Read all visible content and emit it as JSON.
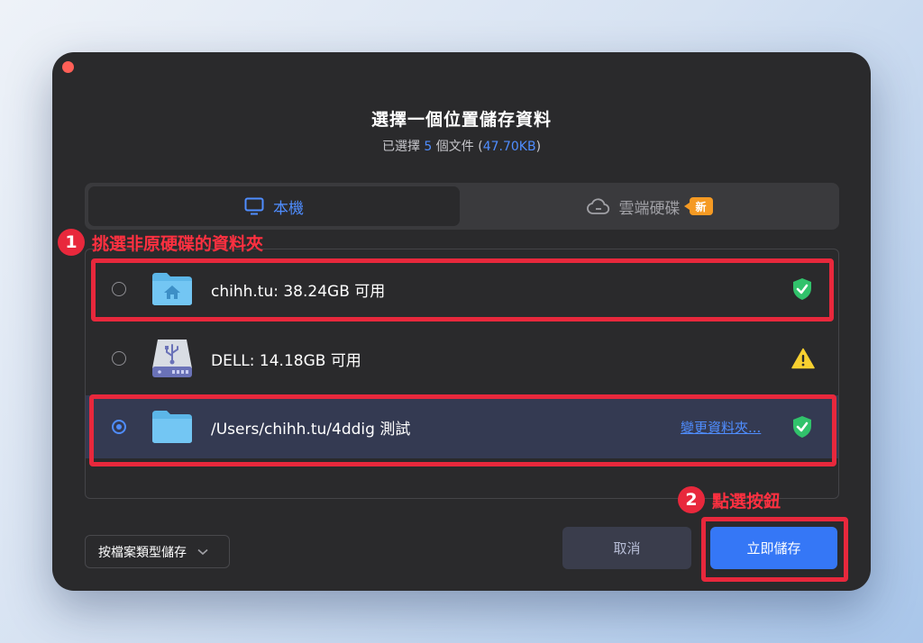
{
  "dialog": {
    "title": "選擇一個位置儲存資料",
    "subtitle_prefix": "已選擇",
    "file_count": "5",
    "subtitle_mid": "個文件",
    "file_size": "47.70KB"
  },
  "tabs": {
    "local_label": "本機",
    "cloud_label": "雲端硬碟",
    "new_badge": "新"
  },
  "locations": [
    {
      "label": "chihh.tu: 38.24GB 可用",
      "icon": "home-folder-icon",
      "status": "green-shield-check",
      "selected": false
    },
    {
      "label": "DELL: 14.18GB 可用",
      "icon": "usb-drive-icon",
      "status": "yellow-warning-triangle",
      "selected": false
    },
    {
      "label": "/Users/chihh.tu/4ddig 測試",
      "icon": "folder-icon",
      "status": "green-shield-check",
      "selected": true,
      "change_link": "變更資料夾..."
    }
  ],
  "annotations": {
    "step1_number": "1",
    "step1_text": "挑選非原硬碟的資料夾",
    "step2_number": "2",
    "step2_text": "點選按鈕"
  },
  "footer": {
    "save_type_label": "按檔案類型儲存",
    "cancel_label": "取消",
    "save_label": "立即儲存"
  },
  "colors": {
    "accent": "#4f8dff",
    "annotation_red": "#e8283c",
    "dialog_bg": "#2a2a2c",
    "save_button": "#3577f6",
    "badge_orange": "#f59a23"
  }
}
